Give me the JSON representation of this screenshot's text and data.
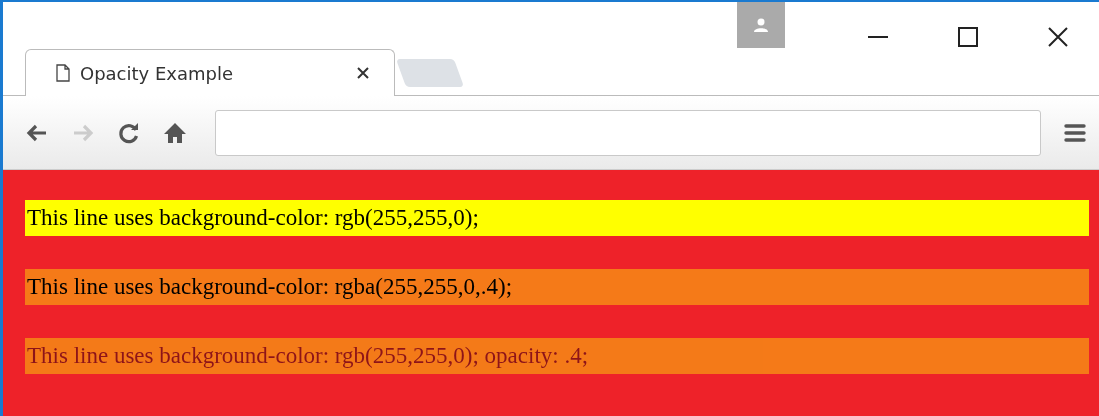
{
  "tab": {
    "title": "Opacity Example",
    "selected": true
  },
  "lines": [
    {
      "kind": "solid",
      "text": "This line uses background-color: rgb(255,255,0);"
    },
    {
      "kind": "rgba",
      "text": "This line uses background-color: rgba(255,255,0,.4);"
    },
    {
      "kind": "opacity",
      "text": "This line uses background-color: rgb(255,255,0); opacity: .4;"
    }
  ]
}
